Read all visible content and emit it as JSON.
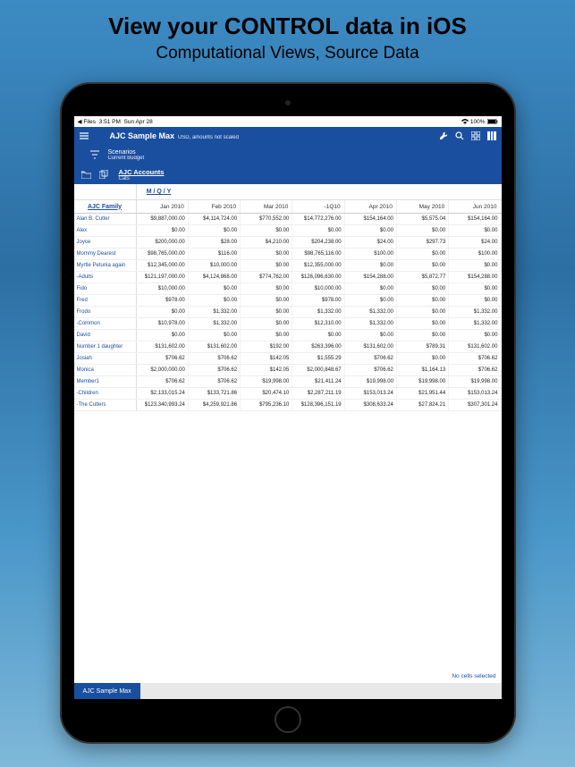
{
  "promo": {
    "title": "View your CONTROL data in iOS",
    "subtitle": "Computational Views, Source Data"
  },
  "statusbar": {
    "back": "Files",
    "time": "3:51 PM",
    "date": "Sun Apr 28",
    "battery": "100%"
  },
  "header": {
    "title": "AJC Sample Max",
    "subtitle": "USD, amounts not scaled"
  },
  "scenarios": {
    "label": "Scenarios",
    "value": "Current Budget"
  },
  "accounts": {
    "label": "AJC Accounts",
    "value": "Cats"
  },
  "mqy": "M / Q / Y",
  "row_header_title": "AJC Family",
  "columns": [
    "Jan 2010",
    "Feb 2010",
    "Mar 2010",
    "-1Q10",
    "Apr 2010",
    "May 2010",
    "Jun 2010"
  ],
  "rows": [
    {
      "label": "Alan B. Cutler",
      "cells": [
        "$9,887,000.00",
        "$4,114,724.00",
        "$770,552.00",
        "$14,772,276.00",
        "$154,164.00",
        "$5,575.04",
        "$154,164.00"
      ]
    },
    {
      "label": "Alex",
      "cells": [
        "$0.00",
        "$0.00",
        "$0.00",
        "$0.00",
        "$0.00",
        "$0.00",
        "$0.00"
      ]
    },
    {
      "label": "Joyce",
      "cells": [
        "$200,000.00",
        "$28.00",
        "$4,210.00",
        "$204,238.00",
        "$24.00",
        "$297.73",
        "$24.00"
      ]
    },
    {
      "label": "Mommy Dearest",
      "cells": [
        "$98,765,000.00",
        "$116.00",
        "$0.00",
        "$98,765,116.00",
        "$100.00",
        "$0.00",
        "$100.00"
      ]
    },
    {
      "label": "Myrtle Petunia again",
      "cells": [
        "$12,345,000.00",
        "$10,000.00",
        "$0.00",
        "$12,355,000.00",
        "$0.00",
        "$0.00",
        "$0.00"
      ]
    },
    {
      "label": "-Adults",
      "cells": [
        "$121,197,000.00",
        "$4,124,868.00",
        "$774,762.00",
        "$126,096,630.00",
        "$154,288.00",
        "$5,872.77",
        "$154,288.00"
      ]
    },
    {
      "label": "Fido",
      "cells": [
        "$10,000.00",
        "$0.00",
        "$0.00",
        "$10,000.00",
        "$0.00",
        "$0.00",
        "$0.00"
      ]
    },
    {
      "label": "Fred",
      "cells": [
        "$978.00",
        "$0.00",
        "$0.00",
        "$978.00",
        "$0.00",
        "$0.00",
        "$0.00"
      ]
    },
    {
      "label": "Frodo",
      "cells": [
        "$0.00",
        "$1,332.00",
        "$0.00",
        "$1,332.00",
        "$1,332.00",
        "$0.00",
        "$1,332.00"
      ]
    },
    {
      "label": "-Common",
      "cells": [
        "$10,978.00",
        "$1,332.00",
        "$0.00",
        "$12,310.00",
        "$1,332.00",
        "$0.00",
        "$1,332.00"
      ]
    },
    {
      "label": "David",
      "cells": [
        "$0.00",
        "$0.00",
        "$0.00",
        "$0.00",
        "$0.00",
        "$0.00",
        "$0.00"
      ]
    },
    {
      "label": "Number 1 daughter",
      "cells": [
        "$131,602.00",
        "$131,602.00",
        "$192.00",
        "$263,396.00",
        "$131,602.00",
        "$789.31",
        "$131,602.00"
      ]
    },
    {
      "label": "Josiah",
      "cells": [
        "$706.62",
        "$706.62",
        "$142.05",
        "$1,555.29",
        "$706.62",
        "$0.00",
        "$706.62"
      ]
    },
    {
      "label": "Monica",
      "cells": [
        "$2,000,000.00",
        "$706.62",
        "$142.05",
        "$2,000,848.67",
        "$706.62",
        "$1,164.13",
        "$706.62"
      ]
    },
    {
      "label": "Member1",
      "cells": [
        "$706.62",
        "$706.62",
        "$19,998.00",
        "$21,411.24",
        "$19,998.00",
        "$19,998.00",
        "$19,998.00"
      ]
    },
    {
      "label": "-Children",
      "cells": [
        "$2,133,015.24",
        "$133,721.86",
        "$20,474.10",
        "$2,287,211.19",
        "$153,013.24",
        "$21,951.44",
        "$153,013.24"
      ]
    },
    {
      "label": "-The Cutlers",
      "cells": [
        "$123,340,993.24",
        "$4,259,921.86",
        "$795,236.10",
        "$128,396,151.19",
        "$308,633.24",
        "$27,824.21",
        "$307,301.24"
      ]
    }
  ],
  "no_cells": "No cells selected",
  "footer_tab": "AJC Sample Max"
}
